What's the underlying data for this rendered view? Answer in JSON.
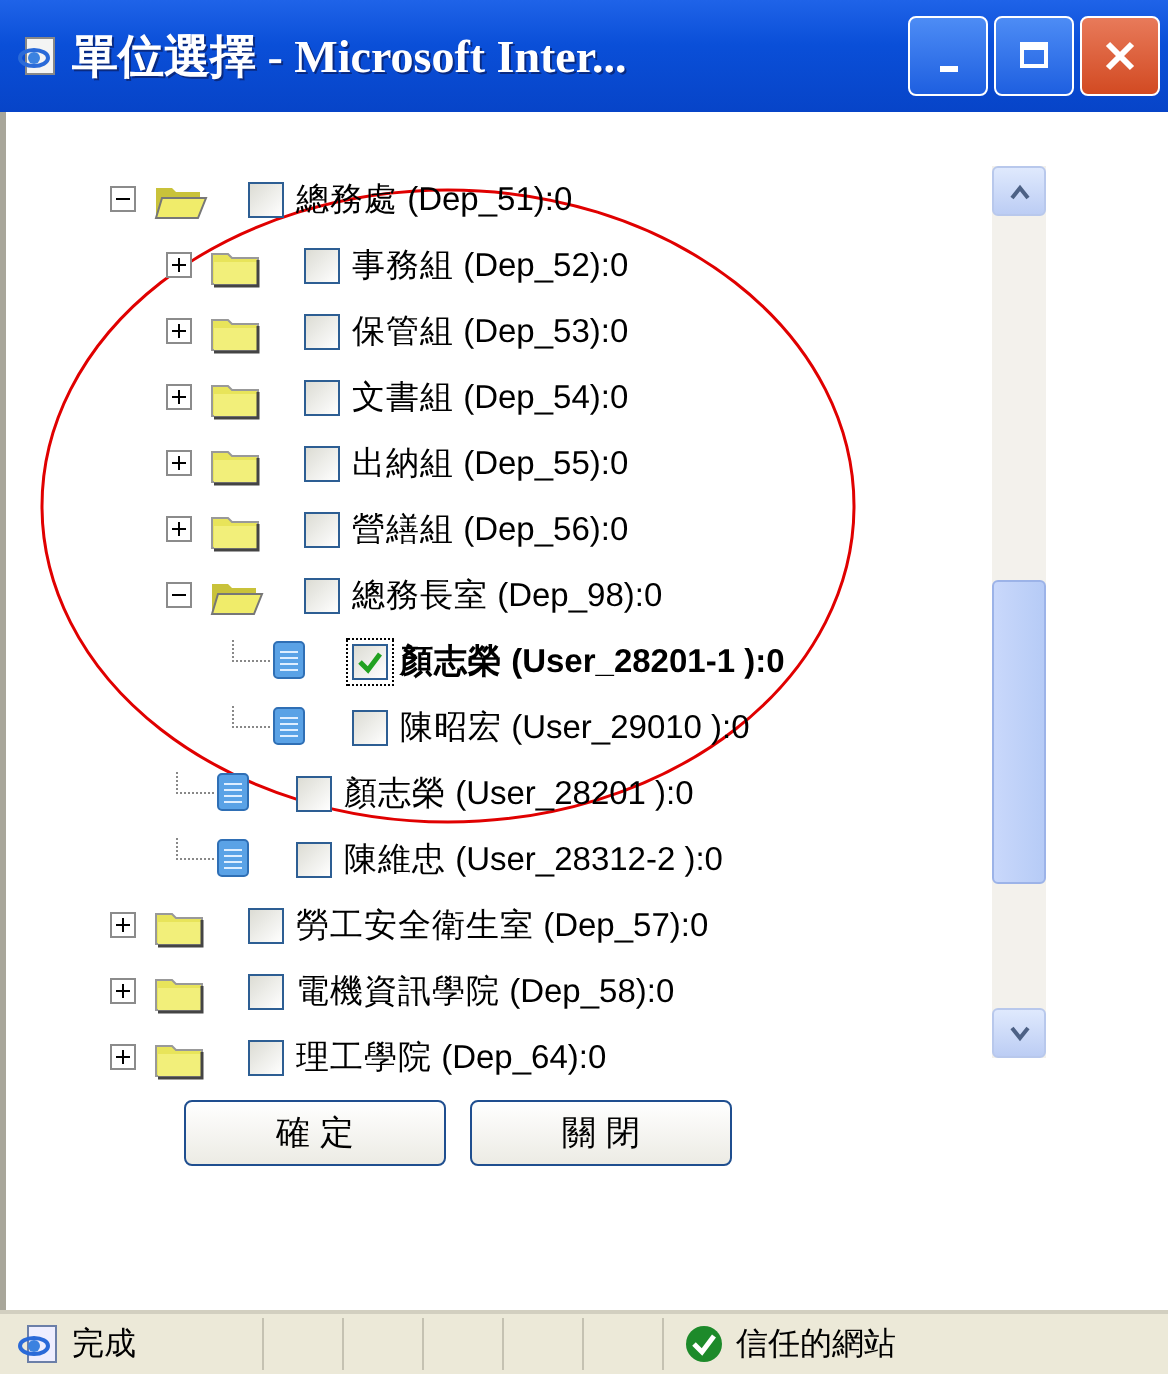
{
  "window": {
    "title": "單位選擇 - Microsoft Inter..."
  },
  "tree": {
    "items": [
      {
        "label": "總務處 (Dep_51):0",
        "kind": "folder",
        "expanded": true,
        "checked": false,
        "selected": false,
        "children": [
          {
            "label": "事務組 (Dep_52):0",
            "kind": "folder",
            "expanded": false,
            "checked": false,
            "selected": false
          },
          {
            "label": "保管組 (Dep_53):0",
            "kind": "folder",
            "expanded": false,
            "checked": false,
            "selected": false
          },
          {
            "label": "文書組 (Dep_54):0",
            "kind": "folder",
            "expanded": false,
            "checked": false,
            "selected": false
          },
          {
            "label": "出納組 (Dep_55):0",
            "kind": "folder",
            "expanded": false,
            "checked": false,
            "selected": false
          },
          {
            "label": "營繕組 (Dep_56):0",
            "kind": "folder",
            "expanded": false,
            "checked": false,
            "selected": false
          },
          {
            "label": "總務長室 (Dep_98):0",
            "kind": "folder",
            "expanded": true,
            "checked": false,
            "selected": false,
            "children": [
              {
                "label": "顏志榮 (User_28201-1 ):0",
                "kind": "user",
                "checked": true,
                "selected": true
              },
              {
                "label": "陳昭宏 (User_29010 ):0",
                "kind": "user",
                "checked": false,
                "selected": false
              }
            ]
          },
          {
            "label": "顏志榮 (User_28201 ):0",
            "kind": "user",
            "checked": false,
            "selected": false
          },
          {
            "label": "陳維忠 (User_28312-2 ):0",
            "kind": "user",
            "checked": false,
            "selected": false
          }
        ]
      },
      {
        "label": "勞工安全衛生室 (Dep_57):0",
        "kind": "folder",
        "expanded": false,
        "checked": false,
        "selected": false
      },
      {
        "label": "電機資訊學院 (Dep_58):0",
        "kind": "folder",
        "expanded": false,
        "checked": false,
        "selected": false
      },
      {
        "label": "理工學院 (Dep_64):0",
        "kind": "folder",
        "expanded": false,
        "checked": false,
        "selected": false
      }
    ]
  },
  "buttons": [
    "確 定",
    "關 閉"
  ],
  "status_bar": {
    "text": "完成",
    "zone": "信任的網站"
  },
  "annotation": {
    "kind": "ellipse"
  }
}
